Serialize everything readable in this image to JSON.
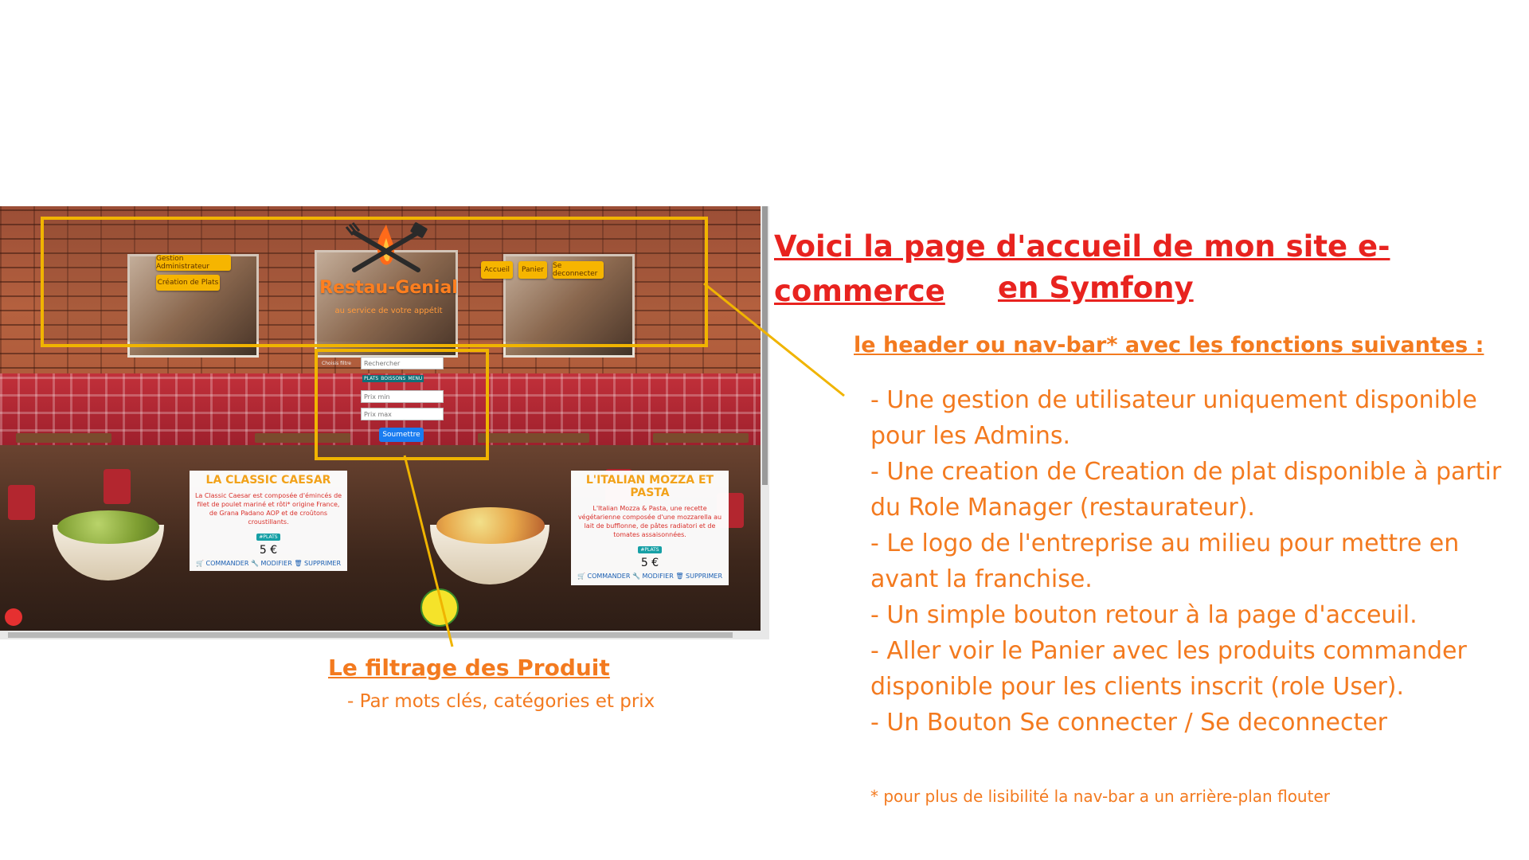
{
  "site": {
    "brand": "Restau-Genial",
    "tagline": "au service de votre appétit",
    "nav": {
      "gestion_admin": "Gestion Administrateur",
      "creation_plats": "Création de Plats",
      "accueil": "Accueil",
      "panier": "Panier",
      "deconnecter": "Se deconnecter"
    },
    "filter": {
      "label": "Choisis filtre",
      "search_placeholder": "Rechercher",
      "categories": [
        "PLATS",
        "BOISSONS",
        "MENU"
      ],
      "prix_min_placeholder": "Prix min",
      "prix_max_placeholder": "Prix max",
      "submit": "Soumettre"
    },
    "products": [
      {
        "title": "LA CLASSIC CAESAR",
        "desc": "La Classic Caesar est composée d'émincés de filet de poulet mariné et rôti* origine France, de Grana Padano AOP et de croûtons croustillants.",
        "badge": "#PLATS",
        "price": "5 €",
        "actions": [
          "COMMANDER",
          "MODIFIER",
          "SUPPRIMER"
        ]
      },
      {
        "title": "L'ITALIAN MOZZA ET PASTA",
        "desc": "L'Italian Mozza & Pasta, une recette végétarienne composée d'une mozzarella au lait de bufflonne, de pâtes radiatori et de tomates assaisonnées.",
        "badge": "#PLATS",
        "price": "5 €",
        "actions": [
          "COMMANDER",
          "MODIFIER",
          "SUPPRIMER"
        ]
      }
    ]
  },
  "annotations": {
    "title_line1": "Voici la page d'accueil de mon site e-commerce",
    "title_line2": "en Symfony",
    "subtitle": "le header ou nav-bar* avec les fonctions suivantes :",
    "features": [
      "- Une gestion de utilisateur uniquement disponible\npour les Admins.",
      "- Une creation de Creation de plat disponible à partir\ndu Role Manager (restaurateur).",
      "- Le logo de l'entreprise au milieu pour mettre en\navant la franchise.",
      "- Un simple bouton retour à la page d'acceuil.",
      "- Aller voir le Panier avec les produits commander\ndisponible pour les clients inscrit (role User).",
      "- Un Bouton Se connecter / Se deconnecter"
    ],
    "footnote": "* pour plus de lisibilité la nav-bar a un arrière-plan flouter",
    "filter_title": "Le filtrage des Produit",
    "filter_sub": "- Par mots clés, catégories et prix"
  },
  "colors": {
    "annotation_red": "#e8231f",
    "annotation_orange": "#f37a1f",
    "highlight_yellow": "#f0b400",
    "button_blue": "#1a7cf0"
  }
}
